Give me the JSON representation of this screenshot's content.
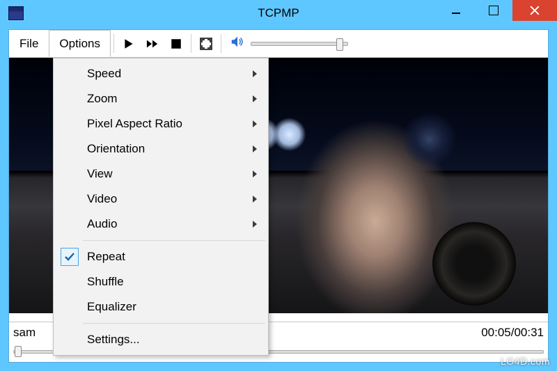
{
  "window": {
    "title": "TCPMP"
  },
  "menubar": {
    "file": "File",
    "options": "Options"
  },
  "options_menu": {
    "speed": "Speed",
    "zoom": "Zoom",
    "pixel_aspect_ratio": "Pixel Aspect Ratio",
    "orientation": "Orientation",
    "view": "View",
    "video": "Video",
    "audio": "Audio",
    "repeat": "Repeat",
    "shuffle": "Shuffle",
    "equalizer": "Equalizer",
    "settings": "Settings...",
    "repeat_checked": true
  },
  "status": {
    "filename_truncated": "sam",
    "time": "00:05/00:31"
  },
  "watermark": "LO4D.com"
}
